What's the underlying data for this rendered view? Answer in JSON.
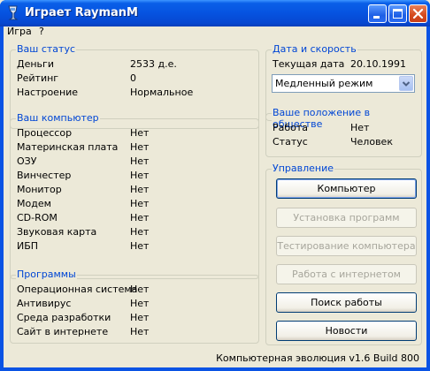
{
  "window": {
    "title": "Играет RaymanM"
  },
  "menu": [
    "Игра",
    "?"
  ],
  "status": {
    "title": "Ваш статус",
    "rows": [
      {
        "label": "Деньги",
        "value": "2533 д.е."
      },
      {
        "label": "Рейтинг",
        "value": "0"
      },
      {
        "label": "Настроение",
        "value": "Нормальное"
      }
    ]
  },
  "computer": {
    "title": "Ваш компьютер",
    "rows": [
      {
        "label": "Процессор",
        "value": "Нет"
      },
      {
        "label": "Материнская плата",
        "value": "Нет"
      },
      {
        "label": "ОЗУ",
        "value": "Нет"
      },
      {
        "label": "Винчестер",
        "value": "Нет"
      },
      {
        "label": "Монитор",
        "value": "Нет"
      },
      {
        "label": "Модем",
        "value": "Нет"
      },
      {
        "label": "CD-ROM",
        "value": "Нет"
      },
      {
        "label": "Звуковая карта",
        "value": "Нет"
      },
      {
        "label": "ИБП",
        "value": "Нет"
      }
    ]
  },
  "programs": {
    "title": "Программы",
    "rows": [
      {
        "label": "Операционная система",
        "value": "Нет"
      },
      {
        "label": "Антивирус",
        "value": "Нет"
      },
      {
        "label": "Среда разработки",
        "value": "Нет"
      },
      {
        "label": "Сайт в интернете",
        "value": "Нет"
      }
    ]
  },
  "date_speed": {
    "title": "Дата и скорость",
    "date_label": "Текущая дата",
    "date_value": "20.10.1991",
    "speed_selected": "Медленный режим"
  },
  "society": {
    "title": "Ваше положение в обществе",
    "rows": [
      {
        "label": "Работа",
        "value": "Нет"
      },
      {
        "label": "Статус",
        "value": "Человек"
      }
    ]
  },
  "control": {
    "title": "Управление",
    "buttons": [
      {
        "label": "Компьютер",
        "enabled": true
      },
      {
        "label": "Установка программ",
        "enabled": false
      },
      {
        "label": "Тестирование компьютера",
        "enabled": false
      },
      {
        "label": "Работа с интернетом",
        "enabled": false
      },
      {
        "label": "Поиск работы",
        "enabled": true
      },
      {
        "label": "Новости",
        "enabled": true
      }
    ]
  },
  "footer": {
    "version": "Компьютерная эволюция v1.6 Build 800"
  },
  "colors": {
    "titlebar": "#0653e0",
    "group_title": "#0046d5",
    "window_bg": "#ece9d8"
  },
  "icons": {
    "app": "app-icon",
    "minimize": "minimize-icon",
    "maximize": "maximize-icon",
    "close": "close-icon",
    "dropdown": "chevron-down-icon"
  }
}
